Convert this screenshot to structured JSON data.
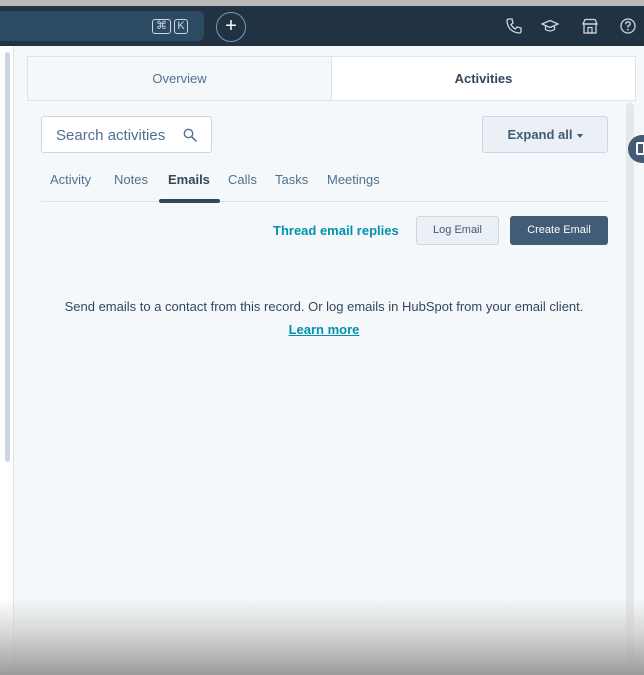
{
  "topbar": {
    "shortcut_cmd": "⌘",
    "shortcut_key": "K",
    "plus_label": "+",
    "icons": [
      "phone-icon",
      "graduation-cap-icon",
      "marketplace-icon",
      "help-icon"
    ]
  },
  "tabs": [
    {
      "label": "Overview",
      "active": false
    },
    {
      "label": "Activities",
      "active": true
    }
  ],
  "search": {
    "placeholder": "Search activities"
  },
  "expand_all": {
    "label": "Expand all"
  },
  "subtabs": [
    {
      "label": "Activity"
    },
    {
      "label": "Notes"
    },
    {
      "label": "Emails",
      "active": true
    },
    {
      "label": "Calls"
    },
    {
      "label": "Tasks"
    },
    {
      "label": "Meetings"
    }
  ],
  "email_actions": {
    "thread_label": "Thread email replies",
    "log_label": "Log Email",
    "create_label": "Create Email"
  },
  "empty_state": {
    "message": "Send emails to a contact from this record. Or log emails in HubSpot from your email client.",
    "link_label": "Learn more"
  },
  "colors": {
    "topbar": "#213343",
    "accent_link": "#0091ae",
    "primary_button": "#425b76",
    "background": "#f5f8fa"
  }
}
